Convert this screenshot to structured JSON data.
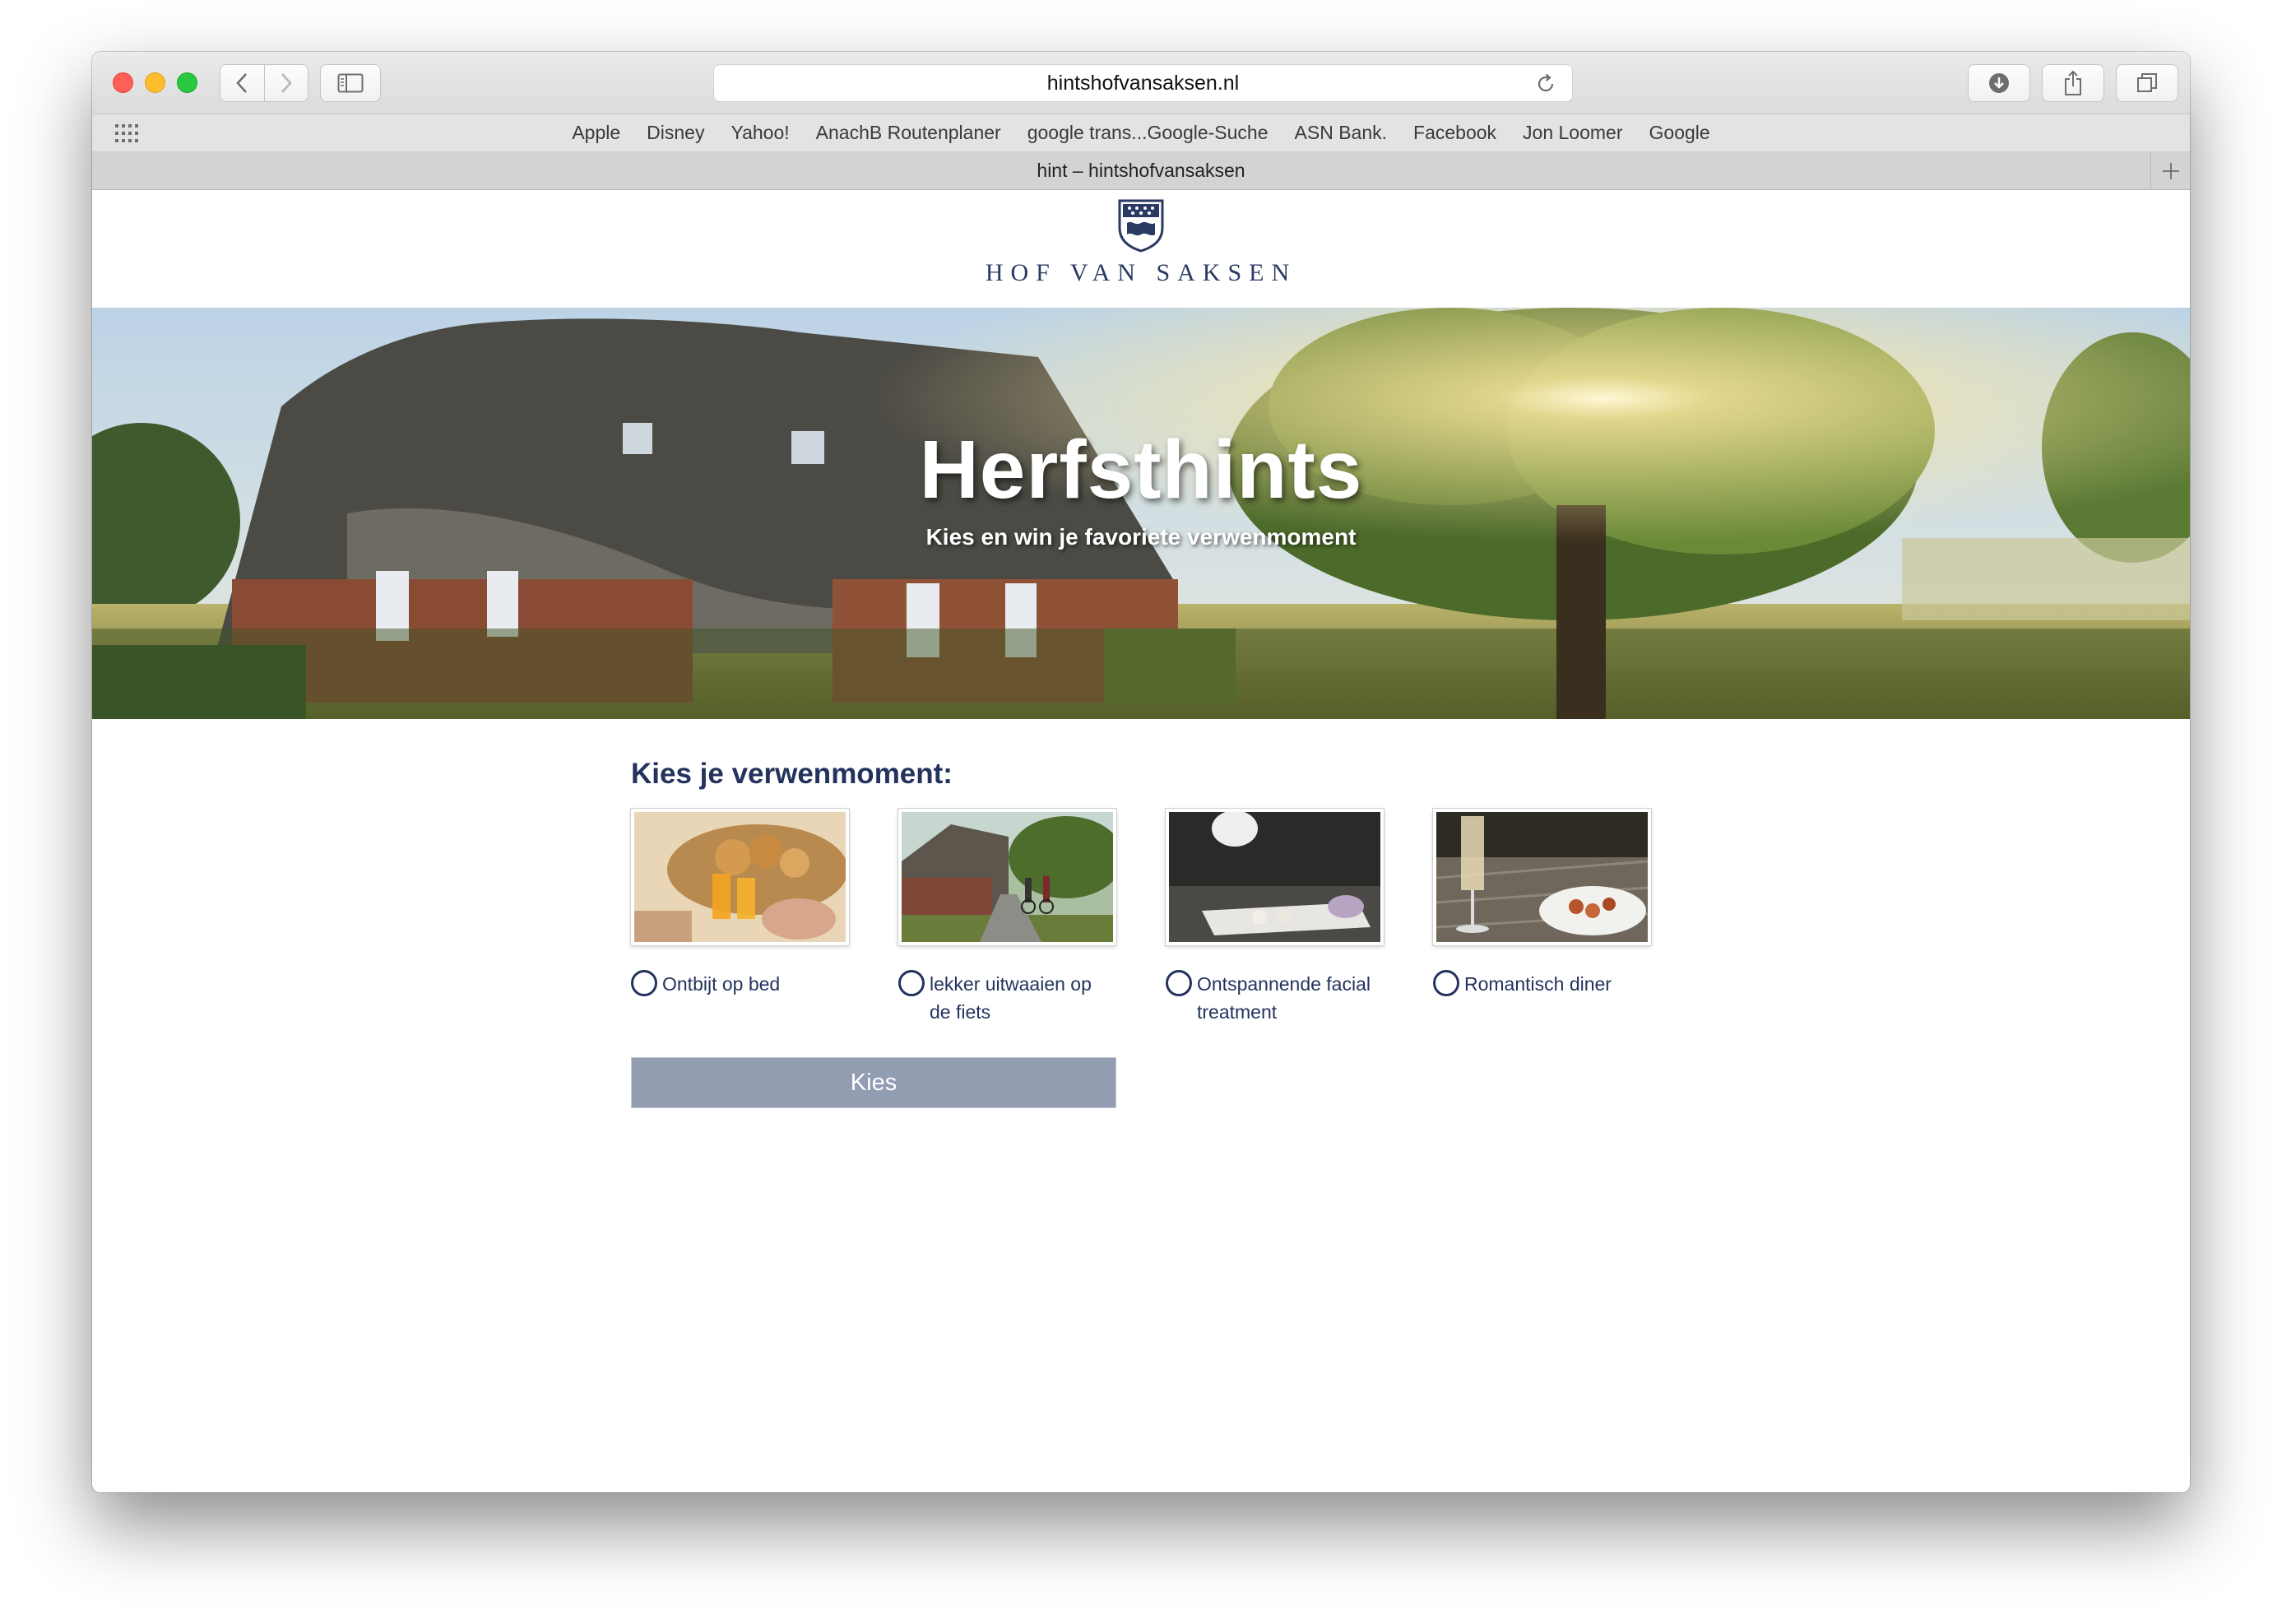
{
  "browser": {
    "url": "hintshofvansaksen.nl",
    "tab_title": "hint – hintshofvansaksen",
    "bookmarks": [
      "Apple",
      "Disney",
      "Yahoo!",
      "AnachB Routenplaner",
      "google trans...Google-Suche",
      "ASN Bank.",
      "Facebook",
      "Jon Loomer",
      "Google"
    ],
    "icons": [
      "back-icon",
      "forward-icon",
      "sidebar-icon",
      "reload-icon",
      "download-icon",
      "share-icon",
      "tabs-icon",
      "grid-icon",
      "plus-icon"
    ]
  },
  "site": {
    "brand": "HOF VAN SAKSEN",
    "hero": {
      "title": "Herfsthints",
      "subtitle": "Kies en win je favoriete verwenmoment"
    },
    "form": {
      "heading": "Kies je verwenmoment:",
      "options": [
        {
          "label": "Ontbijt op bed",
          "selected": false
        },
        {
          "label": "lekker uitwaaien op de fiets",
          "selected": false
        },
        {
          "label": "Ontspannende facial treatment",
          "selected": false
        },
        {
          "label": "Romantisch diner",
          "selected": false
        }
      ],
      "submit_label": "Kies"
    },
    "colors": {
      "brand_navy": "#24335e",
      "button": "#939db2"
    }
  }
}
